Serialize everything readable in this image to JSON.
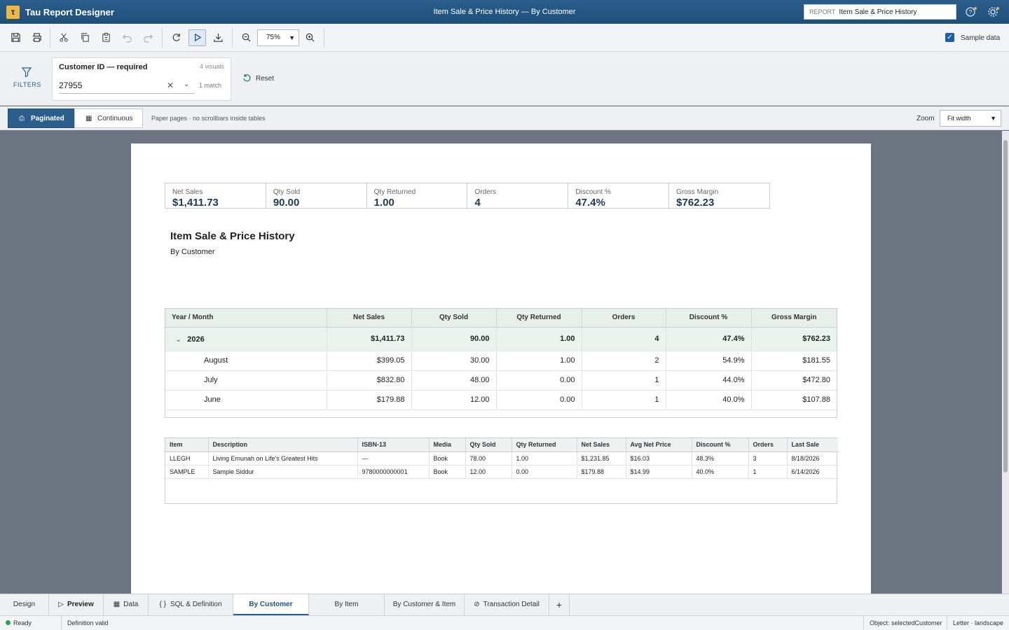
{
  "app": {
    "logo_letter": "τ",
    "name": "Tau Report Designer",
    "window_title": "Item Sale & Price History — By Customer"
  },
  "report_box": {
    "label": "REPORT",
    "value": "Item Sale & Price History"
  },
  "icons": {
    "help": "help-icon",
    "settings": "gear-icon"
  },
  "toolbar": {
    "zoom": "75%",
    "sample_data_label": "Sample data",
    "sample_data_checked": true
  },
  "filters": {
    "label": "FILTERS",
    "field_label": "Customer ID — required",
    "visuals": "4 visuals",
    "value": "27955",
    "match": "1 match",
    "reset": "Reset"
  },
  "view": {
    "paginated": "Paginated",
    "continuous": "Continuous",
    "note": "Paper pages · no scrollbars inside tables",
    "zoom_label": "Zoom",
    "zoom_value": "Fit width"
  },
  "kpis": [
    {
      "label": "Net Sales",
      "value": "$1,411.73"
    },
    {
      "label": "Qty Sold",
      "value": "90.00"
    },
    {
      "label": "Qty Returned",
      "value": "1.00"
    },
    {
      "label": "Orders",
      "value": "4"
    },
    {
      "label": "Discount %",
      "value": "47.4%"
    },
    {
      "label": "Gross Margin",
      "value": "$762.23"
    }
  ],
  "report": {
    "title": "Item Sale & Price History",
    "subtitle": "By Customer"
  },
  "pivot": {
    "headers": [
      "Year / Month",
      "Net Sales",
      "Qty Sold",
      "Qty Returned",
      "Orders",
      "Discount %",
      "Gross Margin"
    ],
    "group": [
      "2026",
      "$1,411.73",
      "90.00",
      "1.00",
      "4",
      "47.4%",
      "$762.23"
    ],
    "rows": [
      [
        "August",
        "$399.05",
        "30.00",
        "1.00",
        "2",
        "54.9%",
        "$181.55"
      ],
      [
        "July",
        "$832.80",
        "48.00",
        "0.00",
        "1",
        "44.0%",
        "$472.80"
      ],
      [
        "June",
        "$179.88",
        "12.00",
        "0.00",
        "1",
        "40.0%",
        "$107.88"
      ]
    ]
  },
  "detail": {
    "headers": [
      "Item",
      "Description",
      "ISBN-13",
      "Media",
      "Qty Sold",
      "Qty Returned",
      "Net Sales",
      "Avg Net Price",
      "Discount %",
      "Orders",
      "Last Sale"
    ],
    "rows": [
      [
        "LLEGH",
        "Living Emunah on Life's Greatest Hits",
        "—",
        "Book",
        "78.00",
        "1.00",
        "$1,231.85",
        "$16.03",
        "48.3%",
        "3",
        "8/18/2026"
      ],
      [
        "SAMPLE",
        "Sample Siddur",
        "9780000000001",
        "Book",
        "12.00",
        "0.00",
        "$179.88",
        "$14.99",
        "40.0%",
        "1",
        "6/14/2026"
      ]
    ]
  },
  "tabs": [
    "Design",
    "Preview",
    "Data",
    "SQL & Definition",
    "By Customer",
    "By Item",
    "By Customer & Item",
    "Transaction Detail",
    "+"
  ],
  "status": {
    "ready": "Ready",
    "definition": "Definition valid",
    "object": "Object: selectedCustomer",
    "page": "Letter · landscape"
  },
  "colors": {
    "brand": "#2b5e8c",
    "accent": "#e8b84a",
    "ok": "#2e9e5b"
  }
}
